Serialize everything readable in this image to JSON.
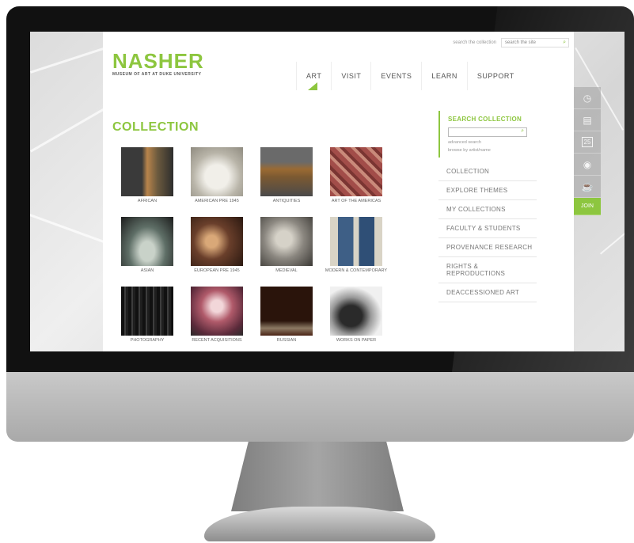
{
  "header": {
    "logo": "NASHER",
    "logo_sub": "MUSEUM OF ART AT DUKE UNIVERSITY",
    "search_collection_link": "search the collection",
    "search_site_placeholder": "search the site"
  },
  "nav": [
    {
      "label": "ART"
    },
    {
      "label": "VISIT"
    },
    {
      "label": "EVENTS"
    },
    {
      "label": "LEARN"
    },
    {
      "label": "SUPPORT"
    }
  ],
  "page_title": "COLLECTION",
  "tiles": [
    {
      "label": "AFRICAN",
      "color": "#6b5a3e"
    },
    {
      "label": "AMERICAN PRE 1945",
      "color": "#c9c6bd"
    },
    {
      "label": "ANTIQUITIES",
      "color": "#7d5a31"
    },
    {
      "label": "ART OF THE AMERICAS",
      "color": "#a24d49"
    },
    {
      "label": "ASIAN",
      "color": "#5f6f67"
    },
    {
      "label": "EUROPEAN PRE 1945",
      "color": "#6a3f2b"
    },
    {
      "label": "MEDIEVAL",
      "color": "#8b8780"
    },
    {
      "label": "MODERN & CONTEMPORARY",
      "color": "#3e5f86"
    },
    {
      "label": "PHOTOGRAPHY",
      "color": "#1f1f1f"
    },
    {
      "label": "RECENT ACQUISITIONS",
      "color": "#b05a6a"
    },
    {
      "label": "RUSSIAN",
      "color": "#4a2416"
    },
    {
      "label": "WORKS ON PAPER",
      "color": "#9a9a9a"
    }
  ],
  "sidebar": {
    "search_heading": "SEARCH COLLECTION",
    "advanced_search": "advanced search",
    "browse_link": "browse by artist/name",
    "items": [
      "COLLECTION",
      "EXPLORE THEMES",
      "MY COLLECTIONS",
      "FACULTY & STUDENTS",
      "PROVENANCE RESEARCH",
      "RIGHTS & REPRODUCTIONS",
      "DEACCESSIONED ART"
    ]
  },
  "rail": {
    "icons": [
      "clock-icon",
      "map-icon",
      "calendar-icon",
      "location-icon",
      "cup-icon"
    ],
    "calendar_day": "25",
    "join_label": "JOIN"
  },
  "colors": {
    "accent": "#8dc63f"
  }
}
